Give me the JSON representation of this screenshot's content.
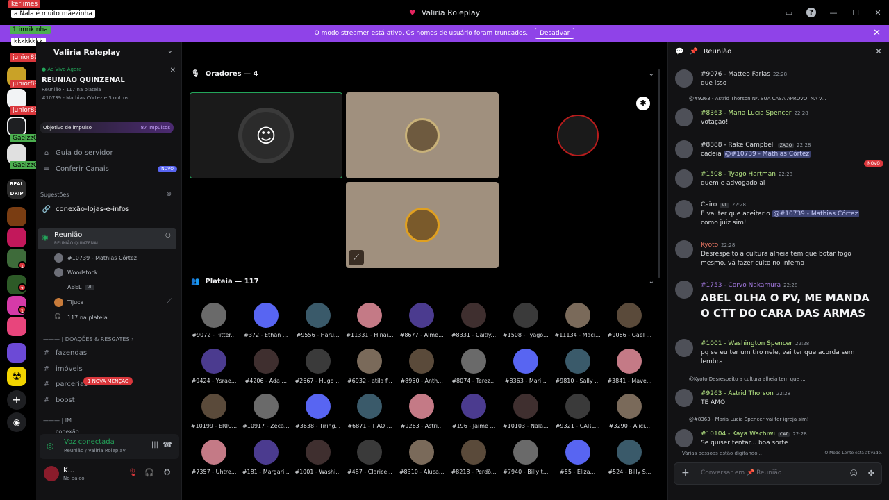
{
  "window": {
    "title": "Valiria Roleplay"
  },
  "banner": {
    "text": "O modo streamer está ativo. Os nomes de usuário foram truncados.",
    "button": "Desativar"
  },
  "rail": {
    "chips": [
      "kerlimes",
      "a Nala é muito mãezinha",
      "imrikinha",
      "kkkkkkkk",
      "junior8955",
      "junior8955",
      "junior8955",
      "GaelzzO",
      "GaelzzO"
    ],
    "chip_badge": "1",
    "badges": [
      "1",
      "2",
      "1"
    ]
  },
  "sidebar": {
    "server_name": "Valiria Roleplay",
    "live_label": "Ao Vivo Agora",
    "event_title": "REUNIÃO QUINZENAL",
    "event_channel": "Reunião",
    "event_audience": "117 na plateia",
    "event_speakers": "#10739 - Mathias Córtez e 3 outros",
    "boost_label": "Objetivo de impulso",
    "boost_count": "87 Impulsos",
    "guide": "Guia do servidor",
    "channels_label": "Conferir Canais",
    "new_badge": "NOVO",
    "suggestions": "Sugestões",
    "suggestion_channel": "conexão-lojas-e-infos",
    "stage_channel": "Reunião",
    "stage_sub": "REUNIÃO QUINZENAL",
    "members": [
      "#10739 - Mathias Córtez",
      "Woodstock",
      "ABEL",
      "Tijuca",
      "117 na plateia"
    ],
    "abel_tag": "VL",
    "category": "| DOAÇÕES & RESGATES",
    "text_channels": [
      "fazendas",
      "imóveis",
      "parcerias",
      "boost"
    ],
    "category2": "| IM",
    "partial_channel": "conexão",
    "mention_badge": "1 NOVA MENÇÃO",
    "voice_status": "Voz conectada",
    "voice_location": "Reunião / Valiria Roleplay",
    "user_name": "K...",
    "user_status": "No palco"
  },
  "stage": {
    "speakers_header": "Oradores — 4",
    "audience_header": "Plateia — 117",
    "audience": [
      "#9072 - Pitter...",
      "#372 - Ethan ...",
      "#9556 - Haru...",
      "#11331 - Hinai...",
      "#8677 - Alme...",
      "#8331 - Caitly...",
      "#1508 - Tyago...",
      "#11134 - Maci...",
      "#9066 - Gael ...",
      "#9424 - Ysrae...",
      "#4206 - Ada ...",
      "#2667 - Hugo ...",
      "#6932 - atila f...",
      "#8950 - Anth...",
      "#8074 - Terez...",
      "#8363 - Mari...",
      "#9810 - Sally ...",
      "#3841 - Mave...",
      "#10199 - ERIC...",
      "#10917 - Zeca...",
      "#3638 - Tiring...",
      "#6871 - TIAO ...",
      "#9263 - Astri...",
      "#196 - Jaime ...",
      "#10103 - Nala...",
      "#9321 - CARL...",
      "#3290 - Alici...",
      "#7357 - Uhtre...",
      "#181 - Margari...",
      "#1001 - Washi...",
      "#487 - Clarice...",
      "#8310 - Aluca...",
      "#8218 - Perdõ...",
      "#7940 - Billy t...",
      "#55 - Eliza...",
      "#524 - Billy S..."
    ]
  },
  "chat": {
    "channel": "Reunião",
    "messages": [
      {
        "name": "#9076 - Matteo Farias",
        "time": "22:28",
        "text": "que isso"
      },
      {
        "reply": "@#9263 - Astrid Thorson NA SUA CASA APROVO, NA V...",
        "name": "#8363 - Maria Lucia Spencer",
        "time": "22:28",
        "text": "votação!"
      },
      {
        "name": "#8888 - Rake Campbell",
        "tag": "ZAGO",
        "time": "22:28",
        "text": "cadeia",
        "mention": "@#10739 - Mathias Córtez"
      },
      {
        "name": "#1508 - Tyago Hartman",
        "time": "22:28",
        "text": "quem e advogado ai"
      },
      {
        "name": "Cairo",
        "tag": "VL",
        "time": "22:28",
        "text": "E vai ter que aceitar o",
        "mention": "@#10739 - Mathias Córtez",
        "text2": "como juiz sim!"
      },
      {
        "name": "Kyoto",
        "time": "22:28",
        "text": "Desrespeito a cultura alheia tem que botar fogo mesmo, vá fazer culto no inferno"
      },
      {
        "name": "#1753 - Corvo Nakamura",
        "time": "22:28",
        "text": "ABEL OLHA O PV, ME MANDA O CTT DO CARA DAS ARMAS"
      },
      {
        "name": "#1001 - Washington  Spencer",
        "time": "22:28",
        "text": "pq se eu ter um tiro nele, vai ter que acorda sem lembra"
      },
      {
        "reply": "@Kyoto Desrespeito a cultura alheia tem que ...",
        "name": "#9263 - Astrid Thorson",
        "time": "22:28",
        "text": "TE AMO"
      },
      {
        "reply": "@#8363 - Maria Lucia Spencer vai ter igreja sim!",
        "name": "#10104 - Kaya Wachiwi",
        "tag": "CAT",
        "time": "22:28",
        "text": "Se quiser tentar... boa sorte"
      }
    ],
    "new_badge": "NOVO",
    "typing": "Várias pessoas estão digitando...",
    "slow_mode": "O Modo Lento está ativado.",
    "input_placeholder": "Conversar em",
    "input_channel": "Reunião"
  },
  "colors": {
    "accent": "#8f43e8",
    "green": "#23a55a",
    "red": "#da373c",
    "blurple": "#5865f2"
  }
}
